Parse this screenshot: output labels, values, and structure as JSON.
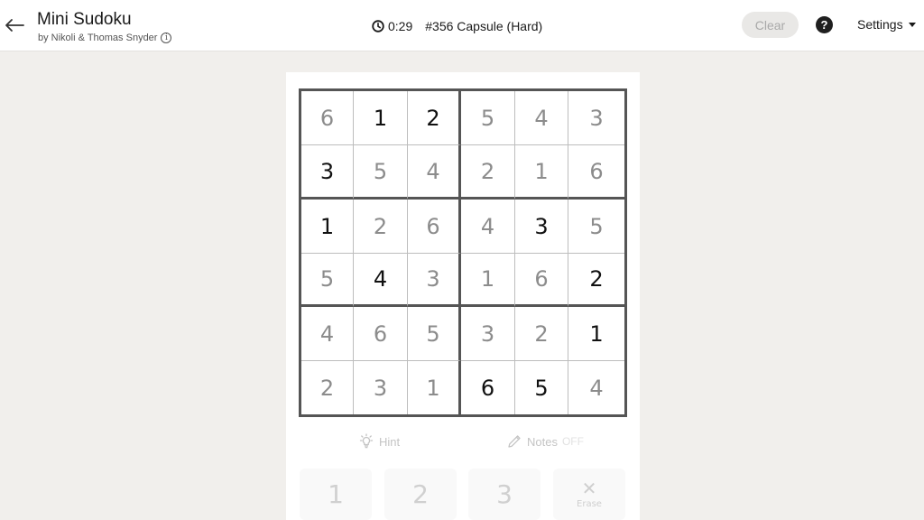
{
  "header": {
    "title": "Mini Sudoku",
    "subtitle": "by Nikoli & Thomas Snyder",
    "timer": "0:29",
    "puzzle": "#356 Capsule (Hard)",
    "clear_label": "Clear",
    "help_label": "?",
    "settings_label": "Settings"
  },
  "board": {
    "rows": [
      [
        {
          "v": "6",
          "given": false
        },
        {
          "v": "1",
          "given": true
        },
        {
          "v": "2",
          "given": true
        },
        {
          "v": "5",
          "given": false
        },
        {
          "v": "4",
          "given": false
        },
        {
          "v": "3",
          "given": false
        }
      ],
      [
        {
          "v": "3",
          "given": true
        },
        {
          "v": "5",
          "given": false
        },
        {
          "v": "4",
          "given": false
        },
        {
          "v": "2",
          "given": false
        },
        {
          "v": "1",
          "given": false
        },
        {
          "v": "6",
          "given": false
        }
      ],
      [
        {
          "v": "1",
          "given": true
        },
        {
          "v": "2",
          "given": false
        },
        {
          "v": "6",
          "given": false
        },
        {
          "v": "4",
          "given": false
        },
        {
          "v": "3",
          "given": true
        },
        {
          "v": "5",
          "given": false
        }
      ],
      [
        {
          "v": "5",
          "given": false
        },
        {
          "v": "4",
          "given": true
        },
        {
          "v": "3",
          "given": false
        },
        {
          "v": "1",
          "given": false
        },
        {
          "v": "6",
          "given": false
        },
        {
          "v": "2",
          "given": true
        }
      ],
      [
        {
          "v": "4",
          "given": false
        },
        {
          "v": "6",
          "given": false
        },
        {
          "v": "5",
          "given": false
        },
        {
          "v": "3",
          "given": false
        },
        {
          "v": "2",
          "given": false
        },
        {
          "v": "1",
          "given": true
        }
      ],
      [
        {
          "v": "2",
          "given": false
        },
        {
          "v": "3",
          "given": false
        },
        {
          "v": "1",
          "given": false
        },
        {
          "v": "6",
          "given": true
        },
        {
          "v": "5",
          "given": true
        },
        {
          "v": "4",
          "given": false
        }
      ]
    ]
  },
  "tools": {
    "hint_label": "Hint",
    "notes_label": "Notes",
    "notes_state": "OFF"
  },
  "keypad": {
    "keys": [
      "1",
      "2",
      "3"
    ],
    "erase_label": "Erase"
  }
}
